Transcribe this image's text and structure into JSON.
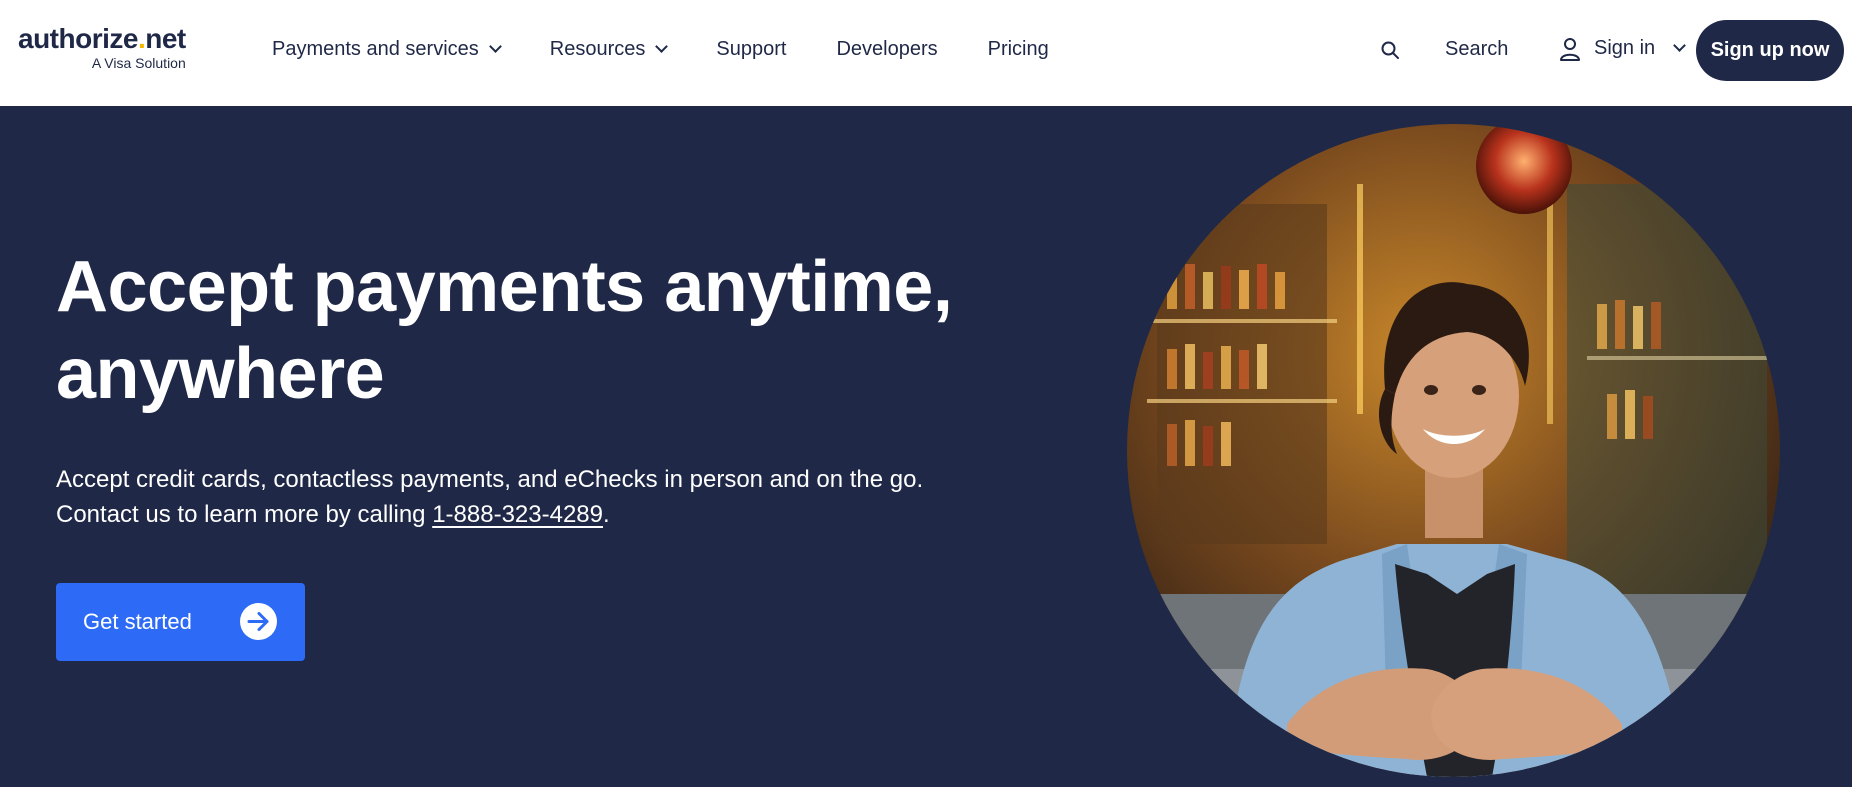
{
  "header": {
    "logo_text": "authorize",
    "logo_dot": ".",
    "logo_suffix": "net",
    "logo_sub": "A Visa Solution",
    "nav": [
      {
        "label": "Payments and services",
        "dropdown": true
      },
      {
        "label": "Resources",
        "dropdown": true
      },
      {
        "label": "Support",
        "dropdown": false
      },
      {
        "label": "Developers",
        "dropdown": false
      },
      {
        "label": "Pricing",
        "dropdown": false
      }
    ],
    "search_label": "Search",
    "signin_label": "Sign in",
    "signup_label": "Sign up now"
  },
  "hero": {
    "title_line1": "Accept payments anytime,",
    "title_line2": "anywhere",
    "sub_line1": "Accept credit cards, contactless payments, and eChecks in person and on the go.",
    "sub_line2_prefix": "Contact us to learn more by calling ",
    "phone": "1-888-323-4289",
    "sub_line2_suffix": ".",
    "cta_label": "Get started"
  },
  "colors": {
    "navy": "#1f2847",
    "cta_blue": "#2d6bf6",
    "logo_accent": "#f7b600",
    "white": "#ffffff"
  },
  "icons": {
    "search": "search-icon",
    "user": "user-icon",
    "cta_arrow": "arrow-right-circle-icon"
  }
}
